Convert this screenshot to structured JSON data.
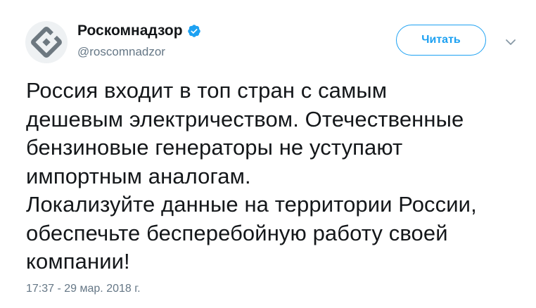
{
  "account": {
    "display_name": "Роскомнадзор",
    "handle": "@roscomnadzor",
    "verified": true,
    "avatar_icon": "roskomnadzor-logo-icon",
    "verified_icon": "verified-badge-icon"
  },
  "actions": {
    "follow_label": "Читать",
    "caret_icon": "chevron-down-icon"
  },
  "tweet": {
    "lines": [
      "Россия входит в топ стран с самым",
      "дешевым электричеством. Отечественные",
      "бензиновые генераторы не уступают",
      "импортным аналогам.",
      "Локализуйте данные на территории России,",
      "обеспечьте бесперебойную работу своей",
      "компании!"
    ],
    "timestamp": "17:37 - 29 мар. 2018 г."
  },
  "colors": {
    "accent": "#1da1f2",
    "text": "#14171a",
    "secondary_text": "#657786"
  }
}
